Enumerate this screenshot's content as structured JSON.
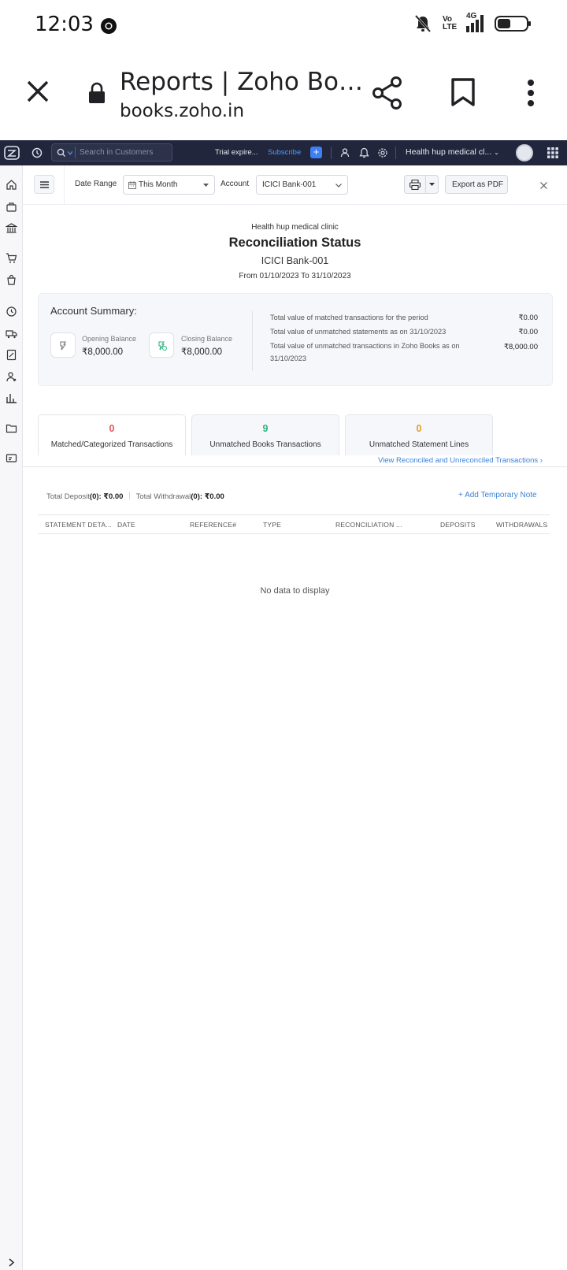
{
  "status_bar": {
    "time": "12:03",
    "icons": [
      "chrome-icon",
      "mute-icon",
      "volte-icon",
      "signal-4g-icon",
      "battery-icon"
    ],
    "network": "4G",
    "volte": "Vo LTE"
  },
  "browser": {
    "title": "Reports | Zoho Bo…",
    "url": "books.zoho.in"
  },
  "topnav": {
    "search_placeholder": "Search in Customers",
    "trial": "Trial expire...",
    "subscribe": "Subscribe",
    "org": "Health hup medical cl..."
  },
  "filters": {
    "date_range_label": "Date Range",
    "date_range_value": "This Month",
    "account_label": "Account",
    "account_value": "ICICI Bank-001",
    "export_label": "Export as PDF"
  },
  "report": {
    "org_name": "Health hup medical clinic",
    "title": "Reconciliation Status",
    "account": "ICICI Bank-001",
    "period": "From 01/10/2023  To 31/10/2023"
  },
  "summary": {
    "title": "Account Summary:",
    "opening_label": "Opening Balance",
    "opening_value": "₹8,000.00",
    "closing_label": "Closing Balance",
    "closing_value": "₹8,000.00",
    "rows": [
      {
        "label": "Total value of matched transactions for the period",
        "value": "₹0.00"
      },
      {
        "label": "Total value of unmatched statements as on 31/10/2023",
        "value": "₹0.00"
      },
      {
        "label": "Total value of unmatched transactions in Zoho Books as on 31/10/2023",
        "value": "₹8,000.00"
      }
    ]
  },
  "tabs": [
    {
      "count": "0",
      "label": "Matched/Categorized Transactions",
      "color": "#e05a5a"
    },
    {
      "count": "9",
      "label": "Unmatched Books Transactions",
      "color": "#2eb67d"
    },
    {
      "count": "0",
      "label": "Unmatched Statement Lines",
      "color": "#e0a020"
    }
  ],
  "view_link": "View Reconciled and Unreconciled Transactions ›",
  "totals": {
    "deposit_label": "Total Deposit",
    "deposit_count": "(0):",
    "deposit_value": "₹0.00",
    "withdrawal_label": "Total Withdrawal",
    "withdrawal_count": "(0):",
    "withdrawal_value": "₹0.00"
  },
  "add_note": "+ Add Temporary Note",
  "table": {
    "columns": [
      "STATEMENT DETA...",
      "DATE",
      "REFERENCE#",
      "TYPE",
      "RECONCILIATION ...",
      "DEPOSITS",
      "WITHDRAWALS"
    ],
    "empty_text": "No data to display"
  }
}
